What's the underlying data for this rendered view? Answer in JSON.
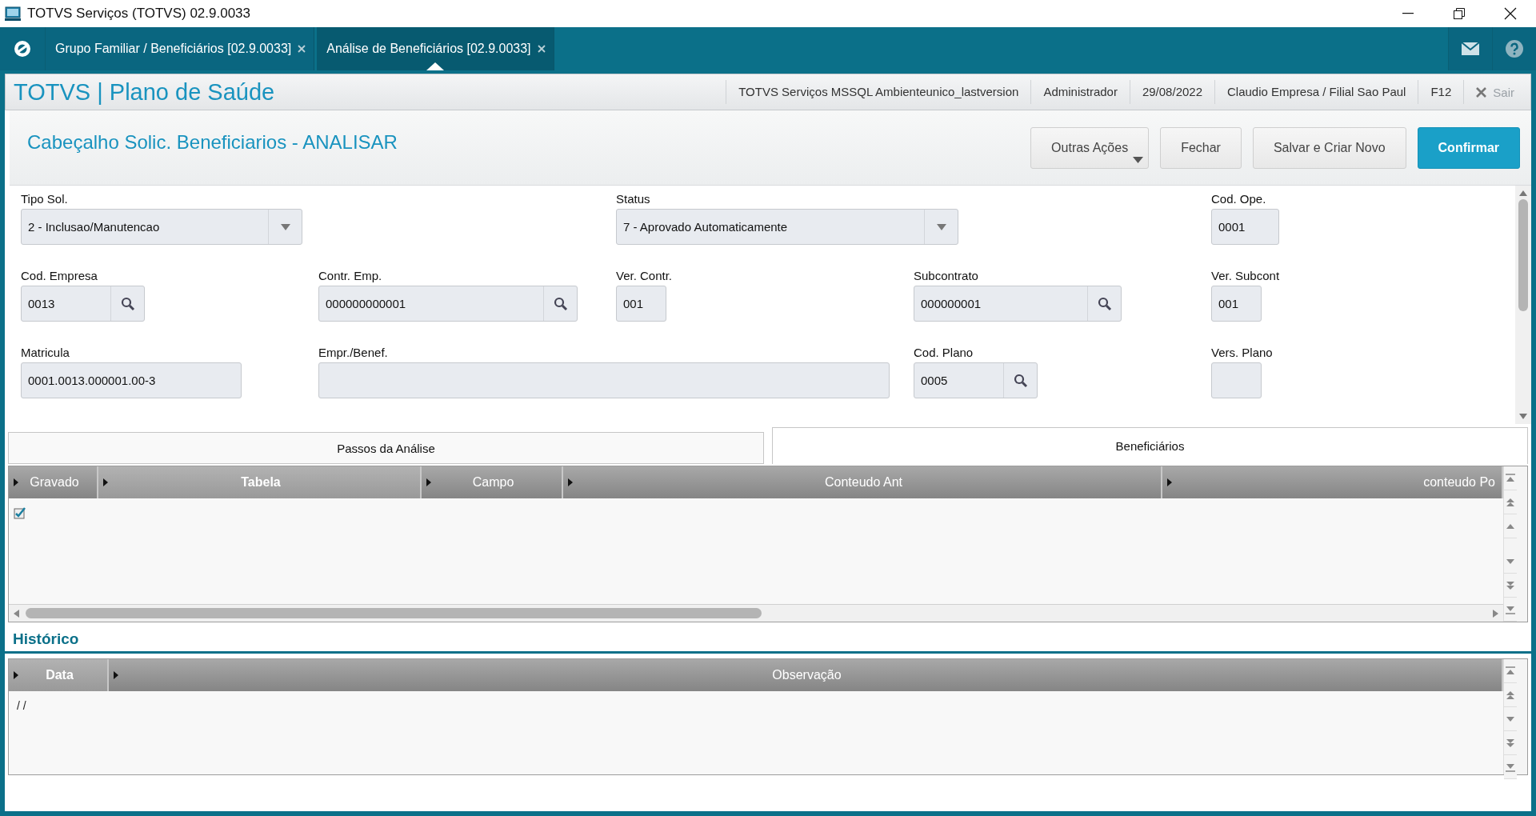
{
  "window": {
    "title": "TOTVS Serviços (TOTVS) 02.9.0033"
  },
  "top_tabs": [
    {
      "label": "Grupo Familiar / Beneficiários [02.9.0033]",
      "selected": false
    },
    {
      "label": "Análise de Beneficiários [02.9.0033]",
      "selected": true
    }
  ],
  "app_bar": {
    "title": "TOTVS | Plano de Saúde",
    "items": [
      "TOTVS Serviços MSSQL Ambienteunico_lastversion",
      "Administrador",
      "29/08/2022",
      "Claudio Empresa / Filial Sao Paul",
      "F12"
    ],
    "exit_label": "Sair"
  },
  "page": {
    "title": "Cabeçalho Solic. Beneficiarios - ANALISAR",
    "actions": [
      {
        "label": "Outras Ações",
        "kind": "menu"
      },
      {
        "label": "Fechar",
        "kind": "normal"
      },
      {
        "label": "Salvar e Criar Novo",
        "kind": "normal"
      },
      {
        "label": "Confirmar",
        "kind": "primary"
      }
    ]
  },
  "form_rows": [
    [
      {
        "label": "Tipo Sol.",
        "value": "2 - Inclusao/Manutencao",
        "kind": "combo"
      },
      {
        "label": "Status",
        "value": "7 - Aprovado Automaticamente",
        "kind": "combo"
      },
      {
        "label": "Cod. Ope.",
        "value": "0001",
        "kind": "text"
      }
    ],
    [
      {
        "label": "Cod. Empresa",
        "value": "0013",
        "kind": "lookup"
      },
      {
        "label": "Contr. Emp.",
        "value": "000000000001",
        "kind": "lookup"
      },
      {
        "label": "Ver. Contr.",
        "value": "001",
        "kind": "text"
      },
      {
        "label": "Subcontrato",
        "value": "000000001",
        "kind": "lookup"
      },
      {
        "label": "Ver. Subcont",
        "value": "001",
        "kind": "text"
      }
    ],
    [
      {
        "label": "Matricula",
        "value": "0001.0013.000001.00-3",
        "kind": "text"
      },
      {
        "label": "Empr./Benef.",
        "kind": "text"
      },
      {
        "label": "Cod. Plano",
        "value": "0005",
        "kind": "lookup"
      },
      {
        "label": "Vers. Plano",
        "kind": "text"
      }
    ]
  ],
  "section_tabs": [
    {
      "label": "Passos da Análise",
      "selected": false
    },
    {
      "label": "Beneficiários",
      "selected": true
    }
  ],
  "changes_table": {
    "columns": [
      {
        "label": "Gravado",
        "selected": false
      },
      {
        "label": "Tabela",
        "selected": true
      },
      {
        "label": "Campo",
        "selected": false
      },
      {
        "label": "Conteudo Ant",
        "selected": false
      },
      {
        "label": "conteudo Po",
        "selected": false
      }
    ],
    "rows": [
      {
        "gravado": true
      }
    ]
  },
  "history": {
    "title": "Histórico",
    "columns": [
      {
        "label": "Data",
        "selected": true
      },
      {
        "label": "Observação",
        "selected": false
      }
    ],
    "rows": [
      {
        "data": "/ /"
      }
    ]
  }
}
